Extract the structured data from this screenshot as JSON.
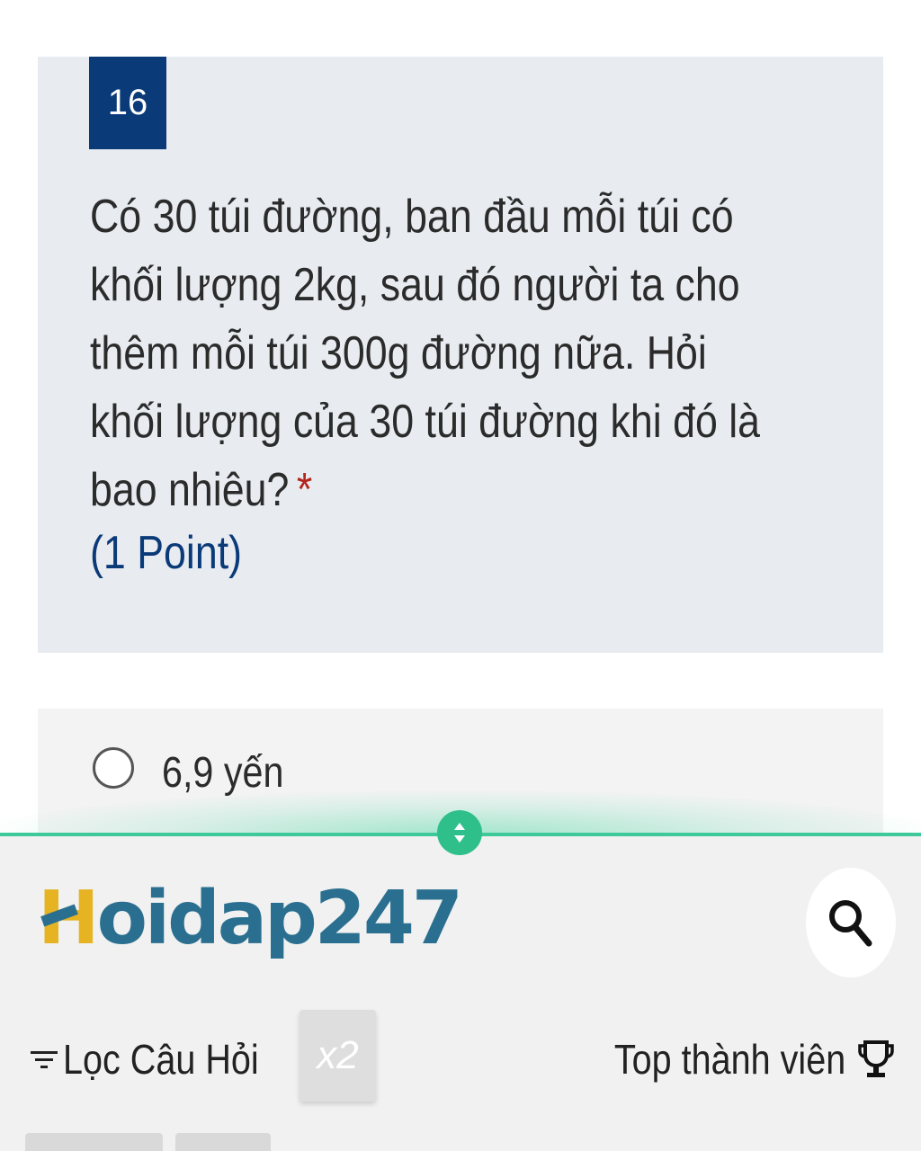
{
  "question": {
    "number": "16",
    "lines": [
      "Có 30 túi đường, ban đầu mỗi túi có",
      "khối lượng 2kg, sau đó người ta cho",
      "thêm mỗi túi 300g  đường nữa. Hỏi",
      "khối lượng của 30 túi đường khi đó là",
      "bao nhiêu?"
    ],
    "required_mark": "*",
    "points": "(1 Point)"
  },
  "options": [
    {
      "label": "6,9 yến",
      "selected": false
    }
  ],
  "sheet": {
    "logo_first": "H",
    "logo_rest": "oidap247",
    "filter_label": "Lọc Câu Hỏi",
    "multiplier_label": "x2",
    "top_members_label": "Top thành viên",
    "icons": {
      "drag": "drag-handle-icon",
      "search": "search-icon",
      "filter": "filter-icon",
      "trophy": "trophy-icon"
    }
  },
  "colors": {
    "question_bg": "#e8ecf1",
    "number_bg": "#0b3a78",
    "accent_green": "#2fbf8a",
    "logo_blue": "#2a6f8f",
    "logo_yellow": "#e6b422",
    "required_red": "#b3261e"
  }
}
